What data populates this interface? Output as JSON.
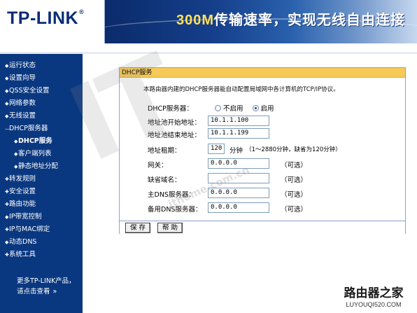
{
  "header": {
    "logo": "TP-LINK",
    "logo_mark": "®",
    "slogan_speed": "300M",
    "slogan_text": "传输速率，实现无线自由连接"
  },
  "sidebar": {
    "items": [
      {
        "label": "运行状态",
        "level": 1
      },
      {
        "label": "设置向导",
        "level": 1
      },
      {
        "label": "QSS安全设置",
        "level": 1
      },
      {
        "label": "网络参数",
        "level": 1
      },
      {
        "label": "无线设置",
        "level": 1
      },
      {
        "label": "DHCP服务器",
        "level": 1
      },
      {
        "label": "DHCP服务",
        "level": 2,
        "active": true
      },
      {
        "label": "客户端列表",
        "level": 2
      },
      {
        "label": "静态地址分配",
        "level": 2
      },
      {
        "label": "转发规则",
        "level": 1
      },
      {
        "label": "安全设置",
        "level": 1
      },
      {
        "label": "路由功能",
        "level": 1
      },
      {
        "label": "IP带宽控制",
        "level": 1
      },
      {
        "label": "IP与MAC绑定",
        "level": 1
      },
      {
        "label": "动态DNS",
        "level": 1
      },
      {
        "label": "系统工具",
        "level": 1
      }
    ],
    "more_line1": "更多TP-LINK产品，",
    "more_line2": "请点击查看",
    "more_arrow": "»"
  },
  "panel": {
    "title": "DHCP服务",
    "intro": "本路由器内建的DHCP服务器能自动配置局域网中各计算机的TCP/IP协议。",
    "dhcp_label": "DHCP服务器：",
    "option_disable": "不启用",
    "option_enable": "启用",
    "selected": "启用",
    "start_label": "地址池开始地址：",
    "start_value": "10.1.1.100",
    "end_label": "地址池结束地址：",
    "end_value": "10.1.1.199",
    "lease_label": "地址租期：",
    "lease_value": "120",
    "lease_unit": "分钟",
    "lease_hint": "（1～2880分钟，缺省为120分钟）",
    "gateway_label": "网关：",
    "gateway_value": "0.0.0.0",
    "domain_label": "缺省域名：",
    "domain_value": "",
    "dns1_label": "主DNS服务器：",
    "dns1_value": "0.0.0.0",
    "dns2_label": "备用DNS服务器：",
    "dns2_value": "0.0.0.0",
    "optional": "（可选）",
    "save_button": "保 存",
    "help_button": "帮 助"
  },
  "watermarks": {
    "logo_text": "IT",
    "url_text": "ithome.com.cn",
    "brand_cn": "路由器之家",
    "brand_url": "LUYOUQI520.COM"
  },
  "colors": {
    "sidebar_bg": "#0a3880",
    "panel_title_bg": "#f7ca57",
    "header_bg": "#0b2b6b"
  }
}
